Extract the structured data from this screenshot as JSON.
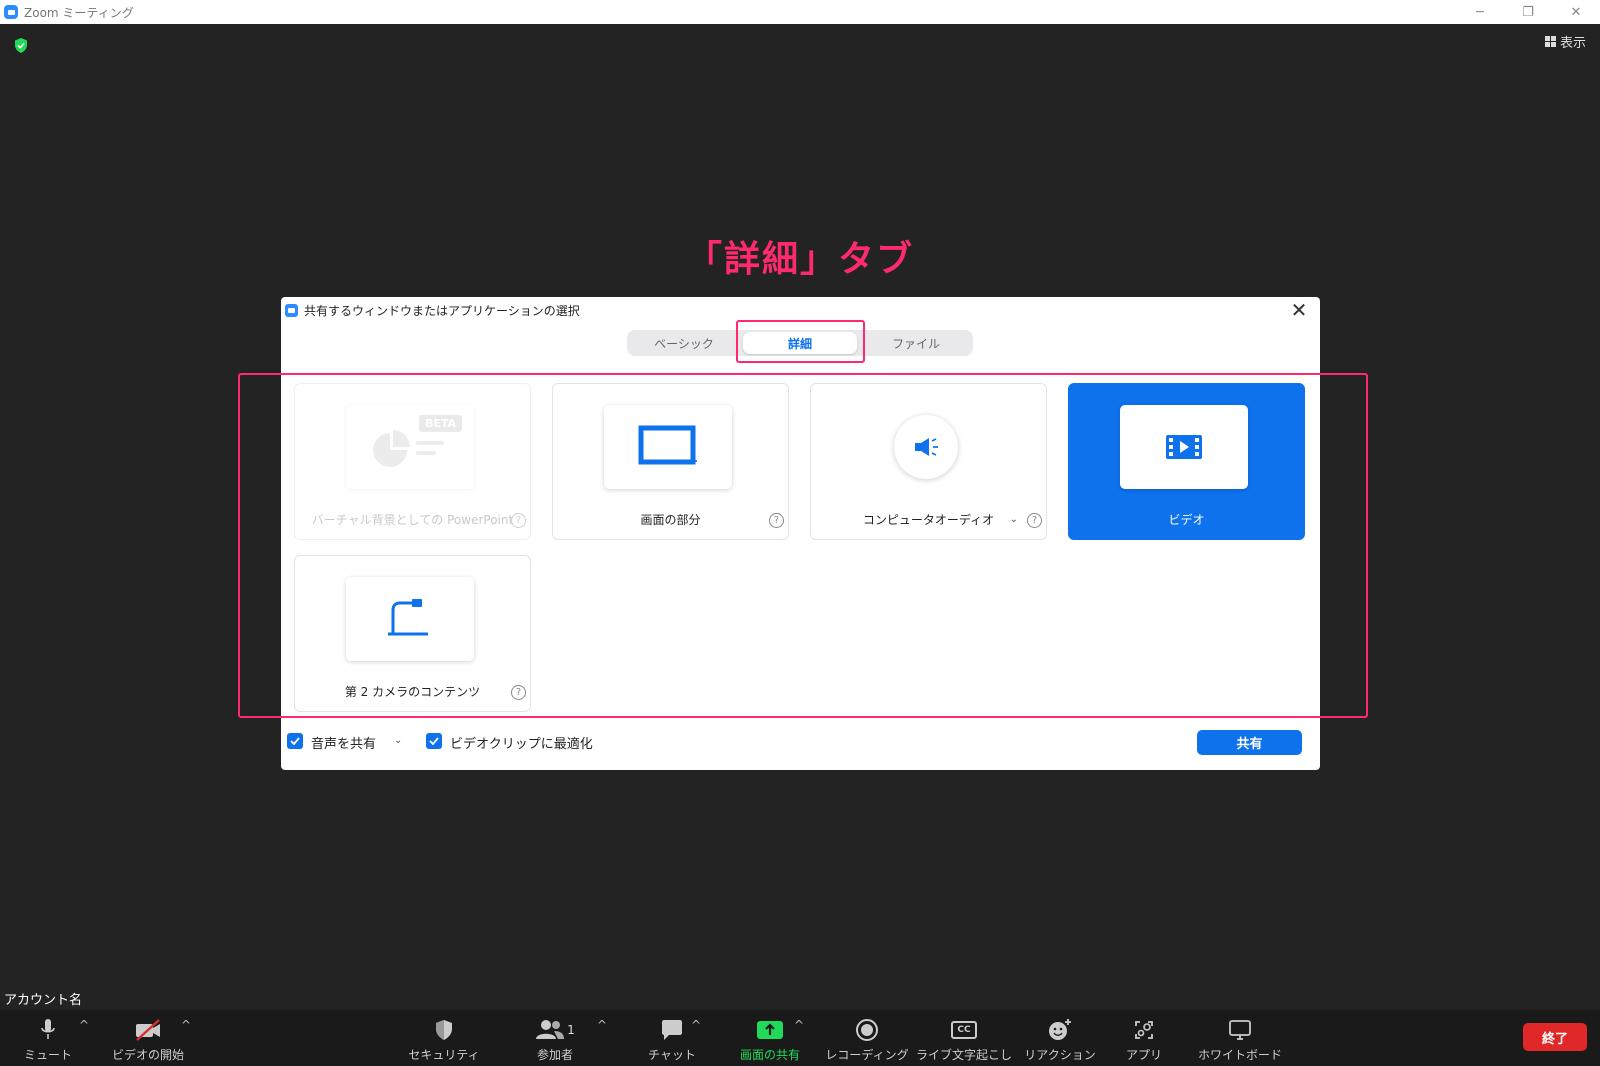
{
  "window": {
    "title": "Zoom ミーティング",
    "view_label": "表示",
    "controls": [
      "minimize",
      "restore",
      "close"
    ]
  },
  "annotation": "「詳細」タブ",
  "dialog": {
    "title": "共有するウィンドウまたはアプリケーションの選択",
    "tabs": [
      {
        "label": "ベーシック",
        "active": false
      },
      {
        "label": "詳細",
        "active": true
      },
      {
        "label": "ファイル",
        "active": false
      }
    ],
    "options": [
      {
        "label": "バーチャル背景としての PowerPoint",
        "badge": "BETA",
        "disabled": true,
        "help": "?"
      },
      {
        "label": "画面の部分",
        "help": "?"
      },
      {
        "label": "コンピュータオーディオ",
        "help": "?",
        "has_dropdown": true
      },
      {
        "label": "ビデオ",
        "selected": true
      },
      {
        "label": "第 2 カメラのコンテンツ",
        "help": "?"
      }
    ],
    "footer": {
      "share_sound": "音声を共有",
      "optimize_video": "ビデオクリップに最適化",
      "share_button": "共有"
    }
  },
  "account_name": "アカウント名",
  "toolbar": {
    "mute": "ミュート",
    "video": "ビデオの開始",
    "security": "セキュリティ",
    "participants": "参加者",
    "participants_count": "1",
    "chat": "チャット",
    "share": "画面の共有",
    "record": "レコーディング",
    "captions": "ライブ文字起こし",
    "reactions": "リアクション",
    "apps": "アプリ",
    "whiteboard": "ホワイトボード",
    "end": "終了",
    "cc_text": "CC"
  },
  "colors": {
    "accent_blue": "#0e72ed",
    "annotation_pink": "#ff2a6d",
    "share_green": "#23d959",
    "end_red": "#e02828",
    "background": "#232323"
  }
}
